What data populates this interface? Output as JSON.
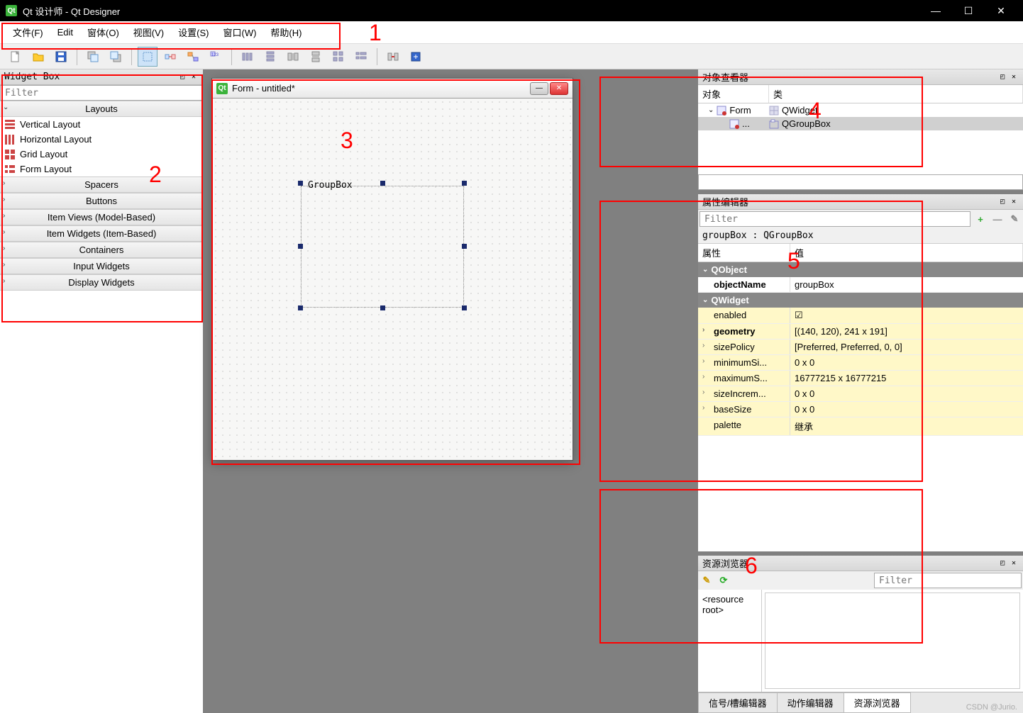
{
  "titlebar": {
    "title": "Qt 设计师 - Qt Designer"
  },
  "menubar": {
    "file": "文件(F)",
    "edit": "Edit",
    "form": "窗体(O)",
    "view": "视图(V)",
    "settings": "设置(S)",
    "window": "窗口(W)",
    "help": "帮助(H)"
  },
  "annotations": {
    "n1": "1",
    "n2": "2",
    "n3": "3",
    "n4": "4",
    "n5": "5",
    "n6": "6"
  },
  "widgetbox": {
    "title": "Widget Box",
    "filter_placeholder": "Filter",
    "categories": {
      "layouts": "Layouts",
      "spacers": "Spacers",
      "buttons": "Buttons",
      "item_views": "Item Views (Model-Based)",
      "item_widgets": "Item Widgets (Item-Based)",
      "containers": "Containers",
      "input_widgets": "Input Widgets",
      "display_widgets": "Display Widgets"
    },
    "layouts_items": {
      "vertical": "Vertical Layout",
      "horizontal": "Horizontal Layout",
      "grid": "Grid Layout",
      "form": "Form Layout"
    }
  },
  "formwin": {
    "title": "Form - untitled*",
    "groupbox_label": "GroupBox"
  },
  "objinspector": {
    "title": "对象查看器",
    "col_object": "对象",
    "col_class": "类",
    "row_form": "Form",
    "row_form_class": "QWidget",
    "row_groupbox": "...",
    "row_groupbox_class": "QGroupBox"
  },
  "propeditor": {
    "title": "属性编辑器",
    "filter_placeholder": "Filter",
    "selection": "groupBox : QGroupBox",
    "col_property": "属性",
    "col_value": "值",
    "group_qobject": "QObject",
    "group_qwidget": "QWidget",
    "props": {
      "objectName": {
        "name": "objectName",
        "value": "groupBox"
      },
      "enabled": {
        "name": "enabled",
        "value": "☑"
      },
      "geometry": {
        "name": "geometry",
        "value": "[(140, 120), 241 x 191]"
      },
      "sizePolicy": {
        "name": "sizePolicy",
        "value": "[Preferred, Preferred, 0, 0]"
      },
      "minimumSize": {
        "name": "minimumSi...",
        "value": "0 x 0"
      },
      "maximumSize": {
        "name": "maximumS...",
        "value": "16777215 x 16777215"
      },
      "sizeIncrement": {
        "name": "sizeIncrem...",
        "value": "0 x 0"
      },
      "baseSize": {
        "name": "baseSize",
        "value": "0 x 0"
      },
      "palette": {
        "name": "palette",
        "value": "继承"
      }
    }
  },
  "resbrowser": {
    "title": "资源浏览器",
    "filter_placeholder": "Filter",
    "root": "<resource root>",
    "tab_signals": "信号/槽编辑器",
    "tab_actions": "动作编辑器",
    "tab_resources": "资源浏览器"
  },
  "watermark": "CSDN @Jurio."
}
